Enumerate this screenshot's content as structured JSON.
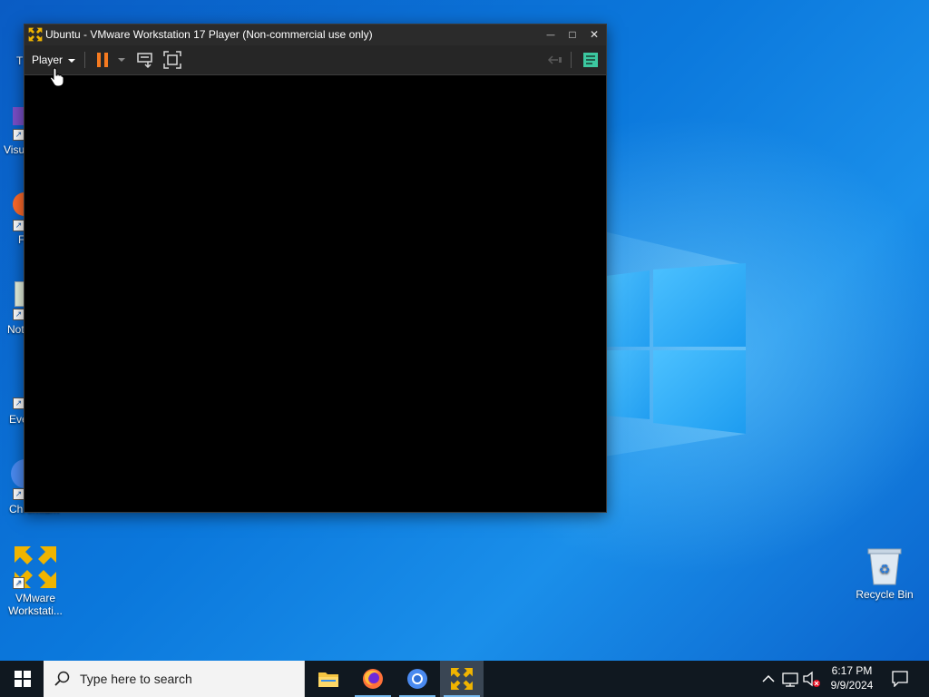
{
  "window": {
    "title": "Ubuntu - VMware Workstation 17 Player (Non-commercial use only)",
    "minimize_glyph": "—",
    "maximize_glyph": "□",
    "close_glyph": "✕"
  },
  "toolbar": {
    "player_menu_label": "Player",
    "icons": [
      "pause-icon",
      "send-ctrl-alt-del-icon",
      "fullscreen-icon",
      "unity-icon",
      "library-icon"
    ]
  },
  "desktop": {
    "icons": [
      {
        "label": "T",
        "icon": "folder-icon"
      },
      {
        "label": "Visu",
        "icon": "visual-studio-icon"
      },
      {
        "label": "F",
        "icon": "firefox-icon"
      },
      {
        "label": "Not",
        "icon": "notepad-icon"
      },
      {
        "label": "Eve",
        "icon": "everything-icon"
      },
      {
        "label": "Chromium",
        "icon": "chromium-icon"
      },
      {
        "label_line1": "VMware",
        "label_line2": "Workstati...",
        "icon": "vmware-icon"
      },
      {
        "label": "Recycle Bin",
        "icon": "recycle-bin-icon"
      }
    ]
  },
  "taskbar": {
    "search_placeholder": "Type here to search",
    "apps": [
      "file-explorer-icon",
      "firefox-icon",
      "chromium-icon",
      "vmware-icon"
    ],
    "active_app": "vmware-icon",
    "tray": [
      "chevron-up-icon",
      "network-icon",
      "volume-muted-icon"
    ],
    "time": "6:17 PM",
    "date": "9/9/2024"
  },
  "colors": {
    "desktop_blue": "#0b78dc",
    "vmware_yellow": "#f0b400",
    "pause_orange": "#f57a20",
    "library_green": "#3cc8a0"
  }
}
